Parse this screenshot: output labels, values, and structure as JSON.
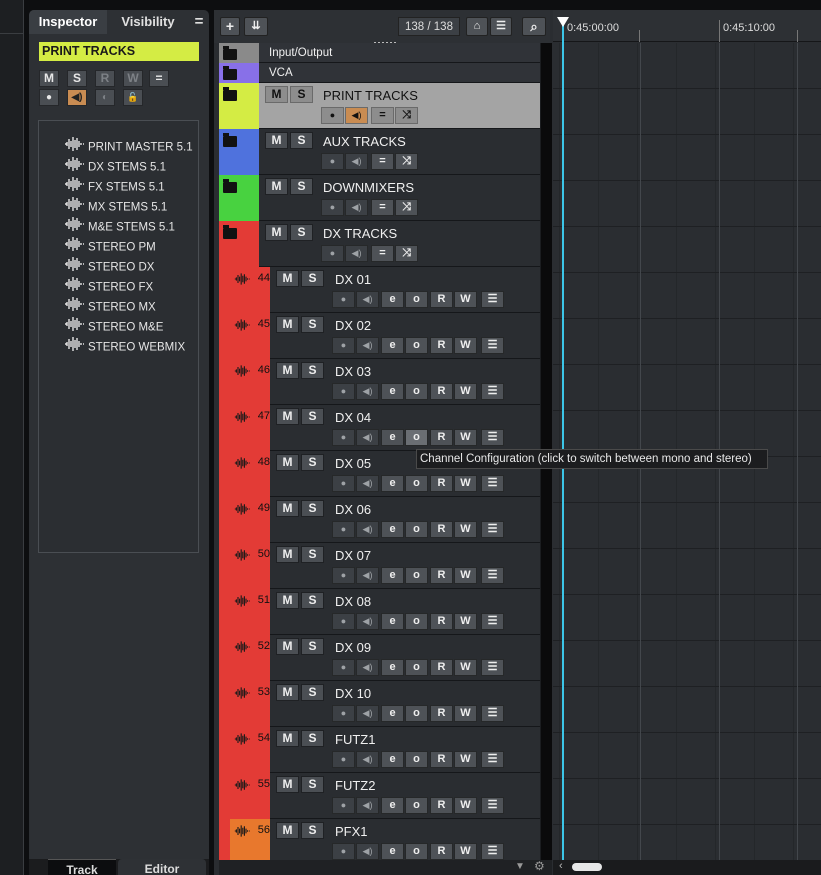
{
  "inspector": {
    "tabs": {
      "inspector": "Inspector",
      "visibility": "Visibility",
      "menu": "="
    },
    "track_title": "PRINT TRACKS",
    "buttons": {
      "m": "M",
      "s": "S",
      "r": "R",
      "w": "W",
      "eq": "=",
      "rec": "●",
      "mon": "◀)",
      "rec_mon": "◐",
      "lock": "🔓"
    },
    "items": [
      "PRINT MASTER 5.1",
      "DX STEMS 5.1",
      "FX STEMS 5.1",
      "MX STEMS 5.1",
      "M&E STEMS 5.1",
      "STEREO PM",
      "STEREO DX",
      "STEREO FX",
      "STEREO MX",
      "STEREO M&E",
      "STEREO WEBMIX"
    ],
    "bottom_tabs": {
      "track": "Track",
      "editor": "Editor"
    }
  },
  "toolbar": {
    "add": "+",
    "folder_add": "⇊",
    "counter": "138 / 138",
    "search": "⌕"
  },
  "ruler": {
    "t1": "0:45:00:00",
    "t2": "0:45:10:00"
  },
  "folder_tracks": [
    {
      "name": "Input/Output",
      "color": "#8a8a8a"
    },
    {
      "name": "VCA",
      "color": "#8870e8"
    },
    {
      "name": "PRINT TRACKS",
      "color": "#d4ec44"
    },
    {
      "name": "AUX TRACKS",
      "color": "#4f72dd"
    },
    {
      "name": "DOWNMIXERS",
      "color": "#48d240"
    },
    {
      "name": "DX TRACKS",
      "color": "#e33b36"
    }
  ],
  "audio_tracks": [
    {
      "num": "44",
      "name": "DX 01"
    },
    {
      "num": "45",
      "name": "DX 02"
    },
    {
      "num": "46",
      "name": "DX 03"
    },
    {
      "num": "47",
      "name": "DX 04"
    },
    {
      "num": "48",
      "name": "DX 05"
    },
    {
      "num": "49",
      "name": "DX 06"
    },
    {
      "num": "50",
      "name": "DX 07"
    },
    {
      "num": "51",
      "name": "DX 08"
    },
    {
      "num": "52",
      "name": "DX 09"
    },
    {
      "num": "53",
      "name": "DX 10"
    },
    {
      "num": "54",
      "name": "FUTZ1"
    },
    {
      "num": "55",
      "name": "FUTZ2"
    },
    {
      "num": "56",
      "name": "PFX1"
    }
  ],
  "track_buttons": {
    "m": "M",
    "s": "S",
    "rec": "●",
    "mon": "◀)",
    "edit": "e",
    "chan": "o",
    "r": "R",
    "w": "W",
    "list": "☰",
    "eq": "=",
    "auto": "⤨"
  },
  "colors": {
    "dx_track": "#e33b36",
    "pfx_track": "#e8782d",
    "cursor": "#3cc6e8"
  },
  "tooltip": "Channel Configuration (click to switch between mono and stereo)"
}
